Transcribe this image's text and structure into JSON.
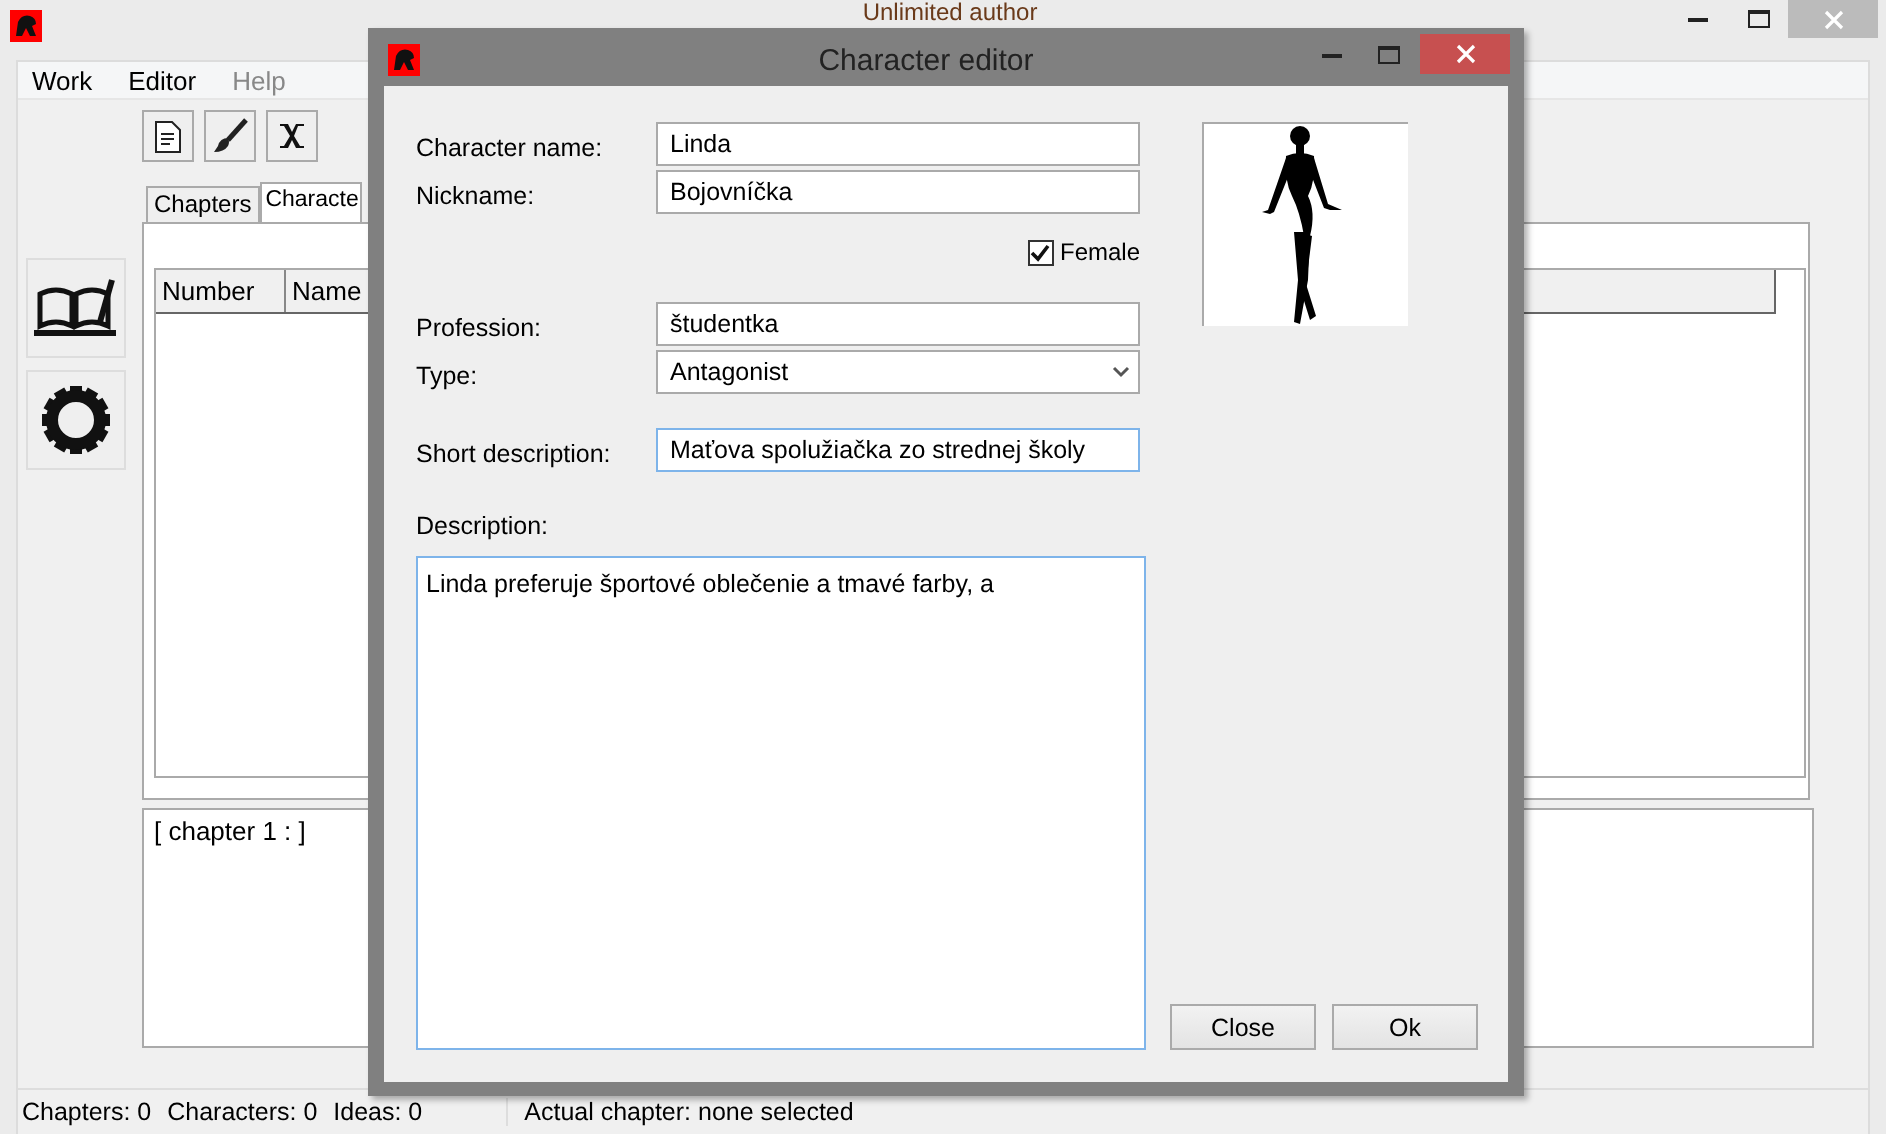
{
  "main_window": {
    "title": "Unlimited author",
    "menu": [
      {
        "label": "Work",
        "disabled": false
      },
      {
        "label": "Editor",
        "disabled": false
      },
      {
        "label": "Help",
        "disabled": true
      }
    ],
    "tabs": [
      {
        "label": "Chapters",
        "selected": false
      },
      {
        "label": "Characte",
        "selected": true
      }
    ],
    "table": {
      "columns": [
        "Number",
        "Name"
      ]
    },
    "chapter_text": "[ chapter 1 :  ]",
    "status_bar": [
      "Chapters: 0",
      "Characters: 0",
      "Ideas: 0",
      "Actual chapter: none selected"
    ]
  },
  "dialog": {
    "title": "Character editor",
    "sections": [
      [
        {
          "kind": "text",
          "label": "Character name:",
          "value": "Linda",
          "focused": false
        },
        {
          "kind": "text",
          "label": "Nickname:",
          "value": "Bojovníčka",
          "focused": false
        },
        {
          "kind": "checkbox",
          "label": "Female",
          "checked": true
        }
      ],
      [
        {
          "kind": "text",
          "label": "Profession:",
          "value": "študentka",
          "focused": false
        },
        {
          "kind": "select",
          "label": "Type:",
          "value": "Antagonist",
          "focused": false
        }
      ],
      [
        {
          "kind": "text",
          "label": "Short description:",
          "value": "Maťova spolužiačka zo strednej školy",
          "focused": true
        }
      ]
    ],
    "description": {
      "label": "Description:",
      "value": "Linda preferuje športové oblečenie a tmavé farby, a",
      "focused": true
    },
    "buttons": [
      "Close",
      "Ok"
    ]
  }
}
